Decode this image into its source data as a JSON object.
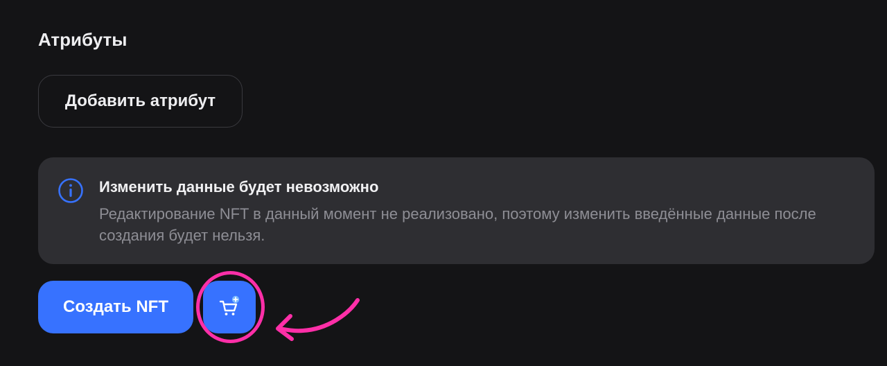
{
  "attributes_section": {
    "title": "Атрибуты",
    "add_button_label": "Добавить атрибут"
  },
  "info_notice": {
    "icon": "info-icon",
    "title": "Изменить данные будет невозможно",
    "text": "Редактирование NFT в данный момент не реализовано, поэтому изменить введённые данные после создания будет нельзя."
  },
  "actions": {
    "create_button_label": "Создать NFT",
    "cart_button_icon": "cart-plus-icon"
  },
  "annotation": {
    "highlight": "pink-circle",
    "arrow": "pink-arrow",
    "color": "#ff2fa8"
  },
  "colors": {
    "background": "#141416",
    "panel": "#2e2e32",
    "accent": "#3772ff",
    "info_icon": "#3772ff",
    "annotation": "#ff2fa8"
  }
}
